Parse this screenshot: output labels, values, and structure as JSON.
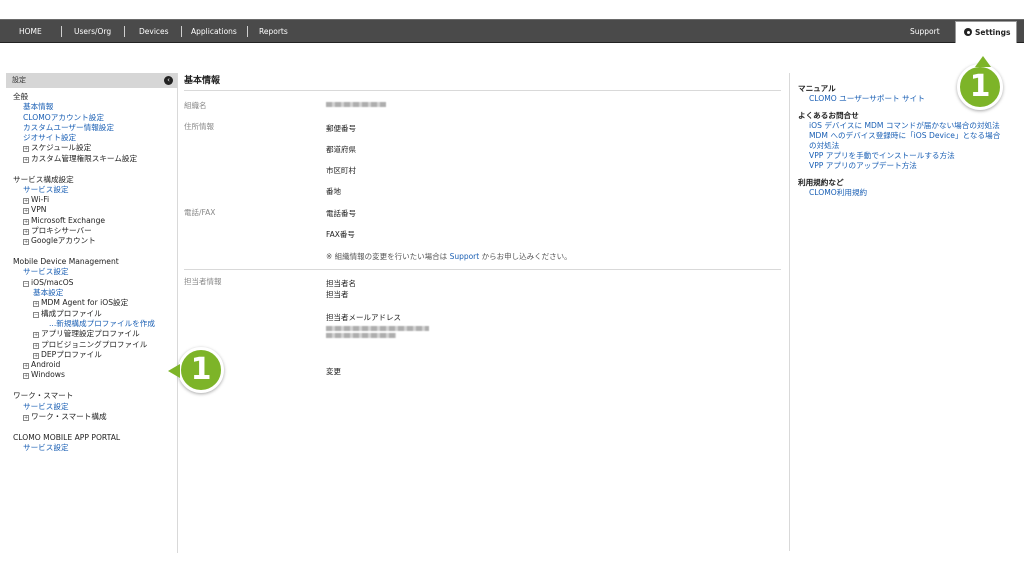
{
  "topnav": {
    "items": [
      "HOME",
      "Users/Org",
      "Devices",
      "Applications",
      "Reports"
    ],
    "support": "Support",
    "settings": "Settings"
  },
  "sidebar": {
    "header": "設定",
    "groups": [
      {
        "title": "全般",
        "items": [
          {
            "label": "基本情報",
            "level": 1,
            "link": true
          },
          {
            "label": "CLOMOアカウント設定",
            "level": 1,
            "link": true
          },
          {
            "label": "カスタムユーザー情報設定",
            "level": 1,
            "link": true
          },
          {
            "label": "ジオサイト設定",
            "level": 1,
            "link": true
          },
          {
            "label": "スケジュール設定",
            "level": 1,
            "box": "+"
          },
          {
            "label": "カスタム管理権限スキーム設定",
            "level": 1,
            "box": "+"
          }
        ]
      },
      {
        "title": "サービス構成設定",
        "items": [
          {
            "label": "サービス設定",
            "level": 1,
            "link": true
          },
          {
            "label": "Wi-Fi",
            "level": 1,
            "box": "+"
          },
          {
            "label": "VPN",
            "level": 1,
            "box": "+"
          },
          {
            "label": "Microsoft Exchange",
            "level": 1,
            "box": "+"
          },
          {
            "label": "プロキシサーバー",
            "level": 1,
            "box": "+"
          },
          {
            "label": "Googleアカウント",
            "level": 1,
            "box": "+"
          }
        ]
      },
      {
        "title": "Mobile Device Management",
        "items": [
          {
            "label": "サービス設定",
            "level": 1,
            "link": true
          },
          {
            "label": "iOS/macOS",
            "level": 1,
            "box": "-"
          },
          {
            "label": "基本設定",
            "level": 2,
            "link": true
          },
          {
            "label": "MDM Agent for iOS設定",
            "level": 2,
            "box": "+"
          },
          {
            "label": "構成プロファイル",
            "level": 2,
            "box": "-"
          },
          {
            "label": "...新規構成プロファイルを作成",
            "level": 4,
            "link": true
          },
          {
            "label": "アプリ管理設定プロファイル",
            "level": 2,
            "box": "+"
          },
          {
            "label": "プロビジョニングプロファイル",
            "level": 2,
            "box": "+"
          },
          {
            "label": "DEPプロファイル",
            "level": 2,
            "box": "+"
          },
          {
            "label": "Android",
            "level": 1,
            "box": "+"
          },
          {
            "label": "Windows",
            "level": 1,
            "box": "+"
          }
        ]
      },
      {
        "title": "ワーク・スマート",
        "items": [
          {
            "label": "サービス設定",
            "level": 1,
            "link": true
          },
          {
            "label": "ワーク・スマート構成",
            "level": 1,
            "box": "+"
          }
        ]
      },
      {
        "title": "CLOMO MOBILE APP PORTAL",
        "items": [
          {
            "label": "サービス設定",
            "level": 1,
            "link": true
          }
        ]
      }
    ]
  },
  "main": {
    "title": "基本情報",
    "org_label": "組織名",
    "address_label": "住所情報",
    "postal": "郵便番号",
    "prefecture": "都道府県",
    "city": "市区町村",
    "street": "番地",
    "phone_label": "電話/FAX",
    "phone": "電話番号",
    "fax": "FAX番号",
    "note_prefix": "※ 組織情報の変更を行いたい場合は ",
    "note_link": "Support",
    "note_suffix": " からお申し込みください。",
    "contact_label": "担当者情報",
    "contact_name_label": "担当者名",
    "contact_name": "担当者",
    "contact_email_label": "担当者メールアドレス",
    "change_link": "変更"
  },
  "right_panel": {
    "manual_heading": "マニュアル",
    "manual_link": "CLOMO ユーザーサポート サイト",
    "faq_heading": "よくあるお問合せ",
    "faq_links": [
      "iOS デバイスに MDM コマンドが届かない場合の対処法",
      "MDM へのデバイス登録時に「iOS Device」となる場合の対処法",
      "VPP アプリを手動でインストールする方法",
      "VPP アプリのアップデート方法"
    ],
    "terms_heading": "利用規約など",
    "terms_link": "CLOMO利用規約"
  },
  "callouts": [
    "1",
    "1"
  ],
  "colors": {
    "topbar": "#4a4a4a",
    "link": "#1a5fb4",
    "callout": "#7db428"
  }
}
